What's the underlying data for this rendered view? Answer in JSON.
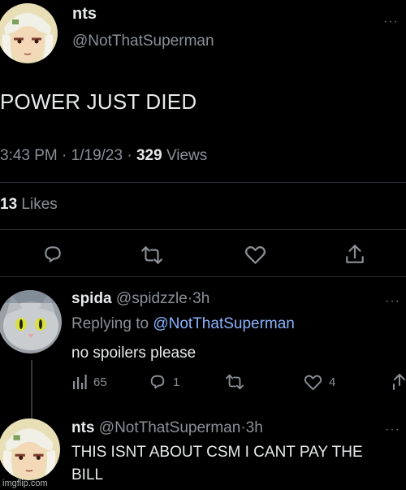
{
  "tweet": {
    "display_name": "nts",
    "handle": "@NotThatSuperman",
    "text": "POWER JUST DIED",
    "time": "3:43 PM",
    "sep1": "·",
    "date": "1/19/23",
    "sep2": "·",
    "views_count": "329",
    "views_label": "Views",
    "likes_count": "13",
    "likes_label": "Likes",
    "more": "···"
  },
  "reply1": {
    "display_name": "spida",
    "handle": "@spidzzle",
    "dot": "·",
    "age": "3h",
    "replying_prefix": "Replying to",
    "replying_to": "@NotThatSuperman",
    "text": "no spoilers please",
    "views": "65",
    "replies": "1",
    "likes": "4",
    "more": "···"
  },
  "reply2": {
    "display_name": "nts",
    "handle": "@NotThatSuperman",
    "dot": "·",
    "age": "3h",
    "text_line1": "THIS ISNT ABOUT CSM I CANT PAY THE",
    "text_line2": "BILL",
    "more": "···"
  },
  "watermark": "imgflip.com",
  "colors": {
    "background": "#000000",
    "text": "#e7e9ea",
    "muted": "#8b9096",
    "link": "#8ab4ff",
    "divider": "#2a2e32"
  },
  "icons": {
    "reply": "comment-bubble-icon",
    "retweet": "retweet-icon",
    "like": "heart-icon",
    "share": "share-upload-icon",
    "views": "bar-chart-icon"
  }
}
